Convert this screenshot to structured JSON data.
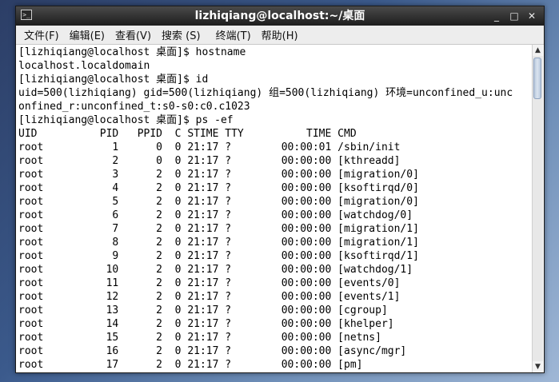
{
  "window": {
    "title": "lizhiqiang@localhost:~/桌面",
    "icon": "terminal-icon",
    "controls": {
      "minimize": "_",
      "maximize": "□",
      "close": "✕"
    }
  },
  "menubar": {
    "items": [
      {
        "label": "文件(F)"
      },
      {
        "label": "编辑(E)"
      },
      {
        "label": "查看(V)"
      },
      {
        "label": "搜索 (S)"
      },
      {
        "label": "终端(T)"
      },
      {
        "label": "帮助(H)"
      }
    ]
  },
  "terminal": {
    "lines": [
      "[lizhiqiang@localhost 桌面]$ hostname",
      "localhost.localdomain",
      "[lizhiqiang@localhost 桌面]$ id",
      "uid=500(lizhiqiang) gid=500(lizhiqiang) 组=500(lizhiqiang) 环境=unconfined_u:unc",
      "onfined_r:unconfined_t:s0-s0:c0.c1023",
      "[lizhiqiang@localhost 桌面]$ ps -ef",
      "UID          PID   PPID  C STIME TTY          TIME CMD",
      "root           1      0  0 21:17 ?        00:00:01 /sbin/init",
      "root           2      0  0 21:17 ?        00:00:00 [kthreadd]",
      "root           3      2  0 21:17 ?        00:00:00 [migration/0]",
      "root           4      2  0 21:17 ?        00:00:00 [ksoftirqd/0]",
      "root           5      2  0 21:17 ?        00:00:00 [migration/0]",
      "root           6      2  0 21:17 ?        00:00:00 [watchdog/0]",
      "root           7      2  0 21:17 ?        00:00:00 [migration/1]",
      "root           8      2  0 21:17 ?        00:00:00 [migration/1]",
      "root           9      2  0 21:17 ?        00:00:00 [ksoftirqd/1]",
      "root          10      2  0 21:17 ?        00:00:00 [watchdog/1]",
      "root          11      2  0 21:17 ?        00:00:00 [events/0]",
      "root          12      2  0 21:17 ?        00:00:00 [events/1]",
      "root          13      2  0 21:17 ?        00:00:00 [cgroup]",
      "root          14      2  0 21:17 ?        00:00:00 [khelper]",
      "root          15      2  0 21:17 ?        00:00:00 [netns]",
      "root          16      2  0 21:17 ?        00:00:00 [async/mgr]",
      "root          17      2  0 21:17 ?        00:00:00 [pm]"
    ]
  },
  "scrollbar": {
    "up": "▲",
    "down": "▼"
  }
}
